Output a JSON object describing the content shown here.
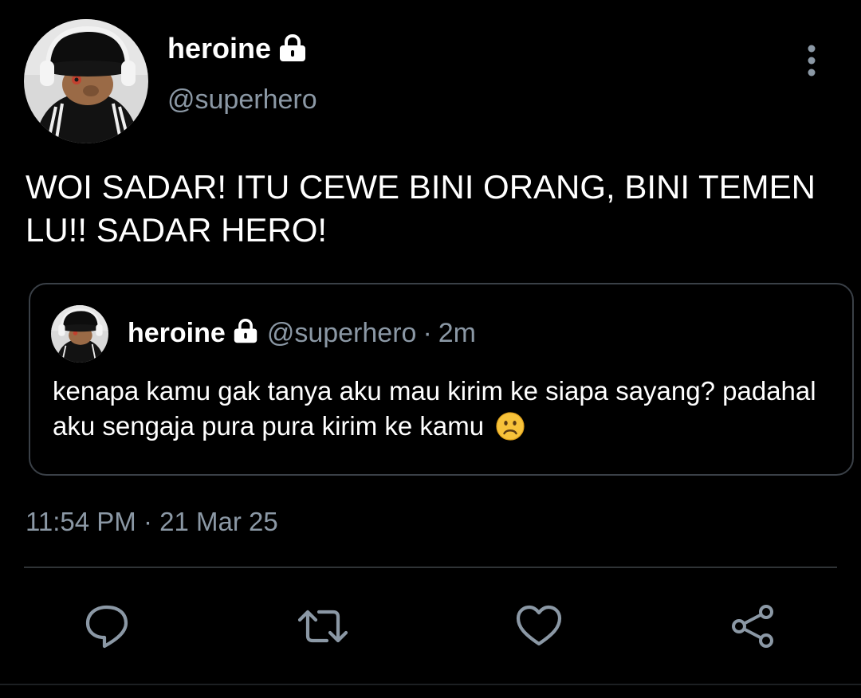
{
  "author": {
    "display_name": "heroine",
    "handle": "@superhero",
    "avatar": "profile-photo",
    "protected_icon": "lock-icon"
  },
  "tweet": {
    "text": "WOI SADAR! ITU CEWE BINI ORANG, BINI TEMEN LU!! SADAR HERO!",
    "time": "11:54 PM",
    "separator": "·",
    "date": "21 Mar 25"
  },
  "quoted": {
    "display_name": "heroine",
    "handle": "@superhero",
    "separator": "·",
    "time_ago": "2m",
    "text": "kenapa kamu gak tanya aku mau kirim ke siapa sayang? padahal aku sengaja pura pura kirim ke kamu",
    "emoji": "frowning-face"
  },
  "actions": [
    {
      "name": "reply",
      "icon": "speech-bubble-icon"
    },
    {
      "name": "retweet",
      "icon": "retweet-icon"
    },
    {
      "name": "like",
      "icon": "heart-icon"
    },
    {
      "name": "share",
      "icon": "share-icon"
    }
  ],
  "colors": {
    "background": "#000000",
    "text": "#ffffff",
    "muted": "#8b98a5",
    "border": "#3a4047",
    "icon": "#8b98a5"
  }
}
